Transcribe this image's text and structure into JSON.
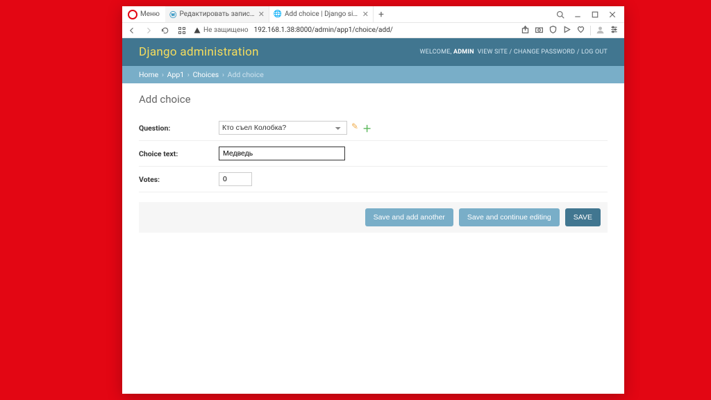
{
  "browser": {
    "menu_label": "Меню",
    "tabs": [
      {
        "favicon": "wp",
        "label": "Редактировать запись \"П..",
        "active": false
      },
      {
        "favicon": "gl",
        "label": "Add choice | Django site a...",
        "active": true
      }
    ],
    "new_tab_plus": "+",
    "window": {
      "search": "⌕",
      "min": "—",
      "max": "□",
      "close": "✕"
    }
  },
  "address_bar": {
    "security": "Не защищено",
    "url": "192.168.1.38:8000/admin/app1/choice/add/"
  },
  "django_header": {
    "title": "Django administration",
    "welcome": "WELCOME,",
    "user": "ADMIN",
    "view_site": "VIEW SITE",
    "change_password": "CHANGE PASSWORD",
    "log_out": "LOG OUT",
    "sep": " / "
  },
  "breadcrumbs": {
    "home": "Home",
    "app": "App1",
    "model": "Choices",
    "page": "Add choice",
    "sep": "›"
  },
  "page": {
    "h1": "Add choice",
    "fields": {
      "question_label": "Question:",
      "question_value": "Кто съел Колобка?",
      "choice_text_label": "Choice text:",
      "choice_text_value": "Медведь",
      "votes_label": "Votes:",
      "votes_value": "0"
    },
    "buttons": {
      "save_add_another": "Save and add another",
      "save_continue": "Save and continue editing",
      "save": "SAVE"
    }
  }
}
